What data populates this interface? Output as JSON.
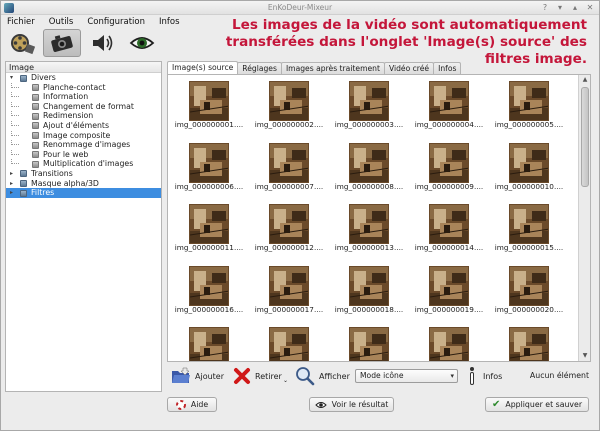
{
  "window": {
    "title": "EnKoDeur-Mixeur"
  },
  "menu": [
    "Fichier",
    "Outils",
    "Configuration",
    "Infos"
  ],
  "toolbar": [
    {
      "icon": "film-reel-icon",
      "active": false
    },
    {
      "icon": "camera-icon",
      "active": true
    },
    {
      "icon": "speaker-icon",
      "active": false
    },
    {
      "icon": "eye-icon",
      "active": false
    }
  ],
  "annotation": {
    "lines": [
      "Les images de la vidéo sont automatiquement",
      "transférées dans l'onglet 'Image(s) source' des",
      "filtres image."
    ]
  },
  "left_panel": {
    "header": "Image",
    "tree": [
      {
        "label": "Divers",
        "level": 0,
        "expander": "▾",
        "selected": false
      },
      {
        "label": "Planche-contact",
        "level": 1,
        "selected": false
      },
      {
        "label": "Information",
        "level": 1,
        "selected": false
      },
      {
        "label": "Changement de format",
        "level": 1,
        "selected": false
      },
      {
        "label": "Redimension",
        "level": 1,
        "selected": false
      },
      {
        "label": "Ajout d'éléments",
        "level": 1,
        "selected": false
      },
      {
        "label": "Image composite",
        "level": 1,
        "selected": false
      },
      {
        "label": "Renommage d'images",
        "level": 1,
        "selected": false
      },
      {
        "label": "Pour le web",
        "level": 1,
        "selected": false
      },
      {
        "label": "Multiplication d'images",
        "level": 1,
        "selected": false
      },
      {
        "label": "Transitions",
        "level": 0,
        "expander": "▸",
        "selected": false
      },
      {
        "label": "Masque alpha/3D",
        "level": 0,
        "expander": "▸",
        "selected": false
      },
      {
        "label": "Filtres",
        "level": 0,
        "expander": "▸",
        "selected": true
      }
    ]
  },
  "tabs": [
    {
      "label": "Image(s) source",
      "active": true
    },
    {
      "label": "Réglages",
      "active": false
    },
    {
      "label": "Images après traitement",
      "active": false
    },
    {
      "label": "Vidéo créé",
      "active": false
    },
    {
      "label": "Infos",
      "active": false
    }
  ],
  "thumbnails": [
    "img_000000001....",
    "img_000000002....",
    "img_000000003....",
    "img_000000004....",
    "img_000000005....",
    "img_000000006....",
    "img_000000007....",
    "img_000000008....",
    "img_000000009....",
    "img_000000010....",
    "img_000000011....",
    "img_000000012....",
    "img_000000013....",
    "img_000000014....",
    "img_000000015....",
    "img_000000016....",
    "img_000000017....",
    "img_000000018....",
    "img_000000019....",
    "img_000000020....",
    "",
    "",
    "",
    "",
    ""
  ],
  "actions": {
    "add": "Ajouter",
    "remove": "Retirer",
    "show": "Afficher",
    "mode": "Mode icône",
    "info": "Infos",
    "status": "Aucun élément"
  },
  "bottom": {
    "help": "Aide",
    "preview": "Voir le résultat",
    "apply": "Appliquer et sauver"
  },
  "colors": {
    "annotation": "#c4163a",
    "selection": "#3d8de0"
  }
}
